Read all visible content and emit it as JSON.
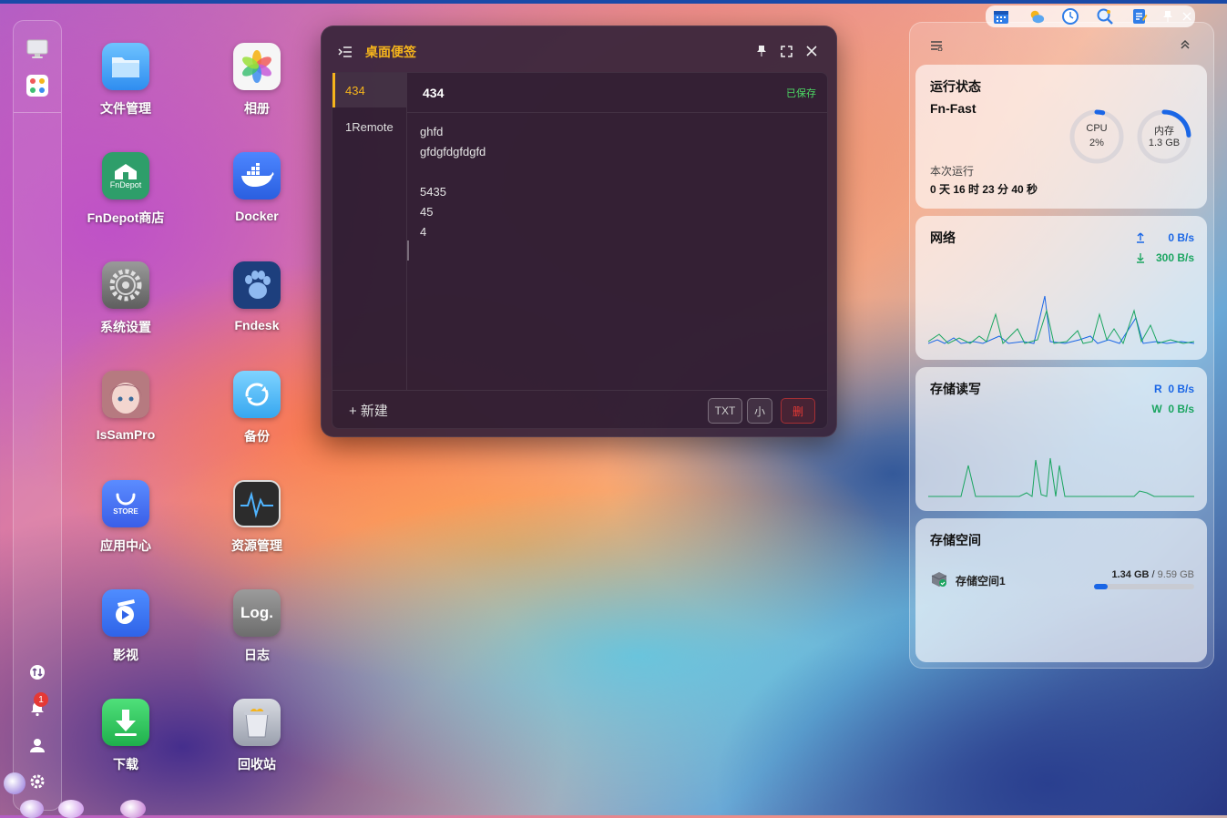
{
  "desktop": {
    "apps": [
      {
        "id": "files",
        "label": "文件管理"
      },
      {
        "id": "photos",
        "label": "相册"
      },
      {
        "id": "fndepot",
        "label": "FnDepot商店",
        "badge": "FnDepot"
      },
      {
        "id": "docker",
        "label": "Docker"
      },
      {
        "id": "settings",
        "label": "系统设置"
      },
      {
        "id": "fndesk",
        "label": "Fndesk"
      },
      {
        "id": "issampro",
        "label": "IsSamPro"
      },
      {
        "id": "backup",
        "label": "备份"
      },
      {
        "id": "store",
        "label": "应用中心",
        "badge": "STORE"
      },
      {
        "id": "resources",
        "label": "资源管理"
      },
      {
        "id": "video",
        "label": "影视"
      },
      {
        "id": "log",
        "label": "日志",
        "badge": "Log."
      },
      {
        "id": "download",
        "label": "下载"
      },
      {
        "id": "trash",
        "label": "回收站"
      }
    ]
  },
  "dock": {
    "notification_count": "1",
    "icons": [
      "monitor-icon",
      "apps-grid-icon",
      "transfer-icon",
      "bell-icon",
      "user-icon",
      "gear-icon"
    ]
  },
  "notes": {
    "title": "桌面便签",
    "list": [
      "434",
      "1Remote"
    ],
    "current_title": "434",
    "saved_status": "已保存",
    "body_lines": [
      "ghfd",
      "gfdgfdgfdgfd",
      "",
      "5435",
      "45",
      "4"
    ],
    "new_label": "+ 新建",
    "btn_txt": "TXT",
    "btn_small": "小",
    "btn_delete": "删"
  },
  "widgets": {
    "status": {
      "title": "运行状态",
      "hostname": "Fn-Fast",
      "uptime_label": "本次运行",
      "uptime": "0 天 16 时 23 分 40 秒",
      "cpu_label": "CPU",
      "cpu_value": "2%",
      "cpu_fraction": 0.02,
      "mem_label": "内存",
      "mem_value": "1.3 GB",
      "mem_fraction": 0.24
    },
    "network": {
      "title": "网络",
      "upload": "0 B/s",
      "download": "300 B/s",
      "upload_color": "#1a66e6",
      "download_color": "#1aa560"
    },
    "disk_io": {
      "title": "存储读写",
      "read_label": "R",
      "read": "0 B/s",
      "write_label": "W",
      "write": "0 B/s"
    },
    "storage": {
      "title": "存储空间",
      "name": "存储空间1",
      "used": "1.34 GB",
      "total": "9.59 GB",
      "fraction": 0.14
    }
  },
  "colors": {
    "accent": "#f5b41c",
    "saved": "#4cd964",
    "delete": "#e53935"
  }
}
